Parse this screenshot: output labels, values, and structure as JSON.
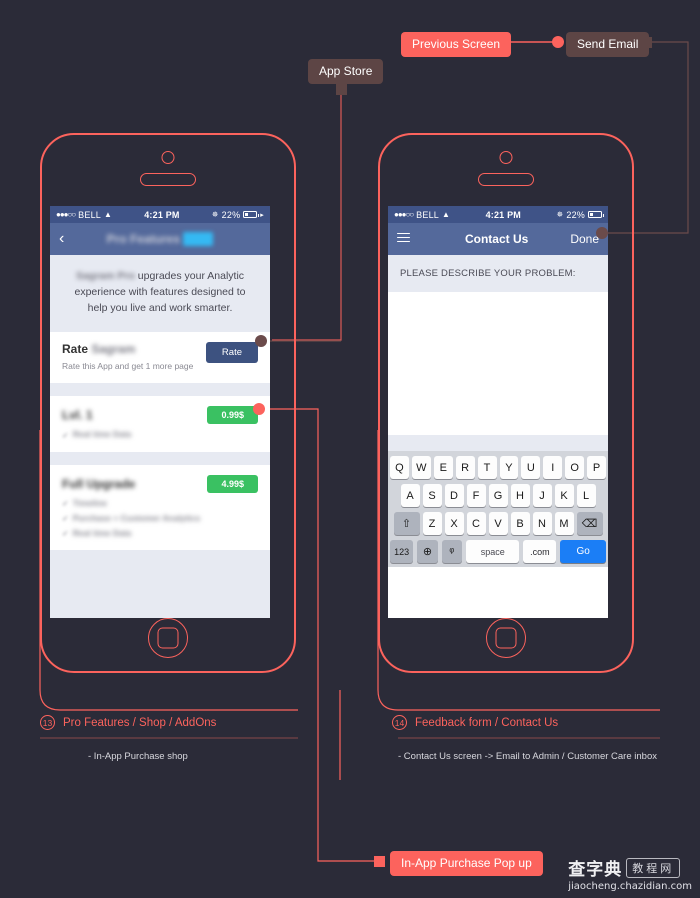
{
  "annotations": {
    "app_store": "App Store",
    "previous_screen": "Previous Screen",
    "send_email": "Send Email",
    "inapp_popup": "In-App Purchase Pop up"
  },
  "left_phone": {
    "statusbar": {
      "dots": "●●●○○",
      "carrier": "BELL",
      "wifi": "▲",
      "time": "4:21 PM",
      "bluetooth": "✵",
      "battery_pct": "22%",
      "arrow": "▸"
    },
    "navbar": {
      "back": "‹",
      "title": "Pro Features",
      "badge": "PRO"
    },
    "intro": {
      "redacted": "Sagram Pro",
      "text": " upgrades your Analytic experience with features designed to help you live and work smarter."
    },
    "rows": [
      {
        "title_plain": "Rate",
        "title_redacted": "Sagram",
        "subtitle": "Rate this App and get 1 more page",
        "button": "Rate",
        "button_type": "rate"
      },
      {
        "title_redacted": "Lvl. 1",
        "features": [
          "Real time Data"
        ],
        "button": "0.99$",
        "button_type": "price"
      },
      {
        "title_redacted": "Full Upgrade",
        "features": [
          "Timeline",
          "Purchase + Customer Analytics",
          "Real time Data"
        ],
        "button": "4.99$",
        "button_type": "price"
      }
    ]
  },
  "right_phone": {
    "statusbar": {
      "dots": "●●●○○",
      "carrier": "BELL",
      "wifi": "▲",
      "time": "4:21 PM",
      "bluetooth": "✵",
      "battery_pct": "22%"
    },
    "navbar": {
      "menu": "menu-icon",
      "title": "Contact Us",
      "action": "Done"
    },
    "form": {
      "label": "PLEASE DESCRIBE YOUR PROBLEM:",
      "textarea_value": ""
    },
    "keyboard": {
      "row1": [
        "Q",
        "W",
        "E",
        "R",
        "T",
        "Y",
        "U",
        "I",
        "O",
        "P"
      ],
      "row2": [
        "A",
        "S",
        "D",
        "F",
        "G",
        "H",
        "J",
        "K",
        "L"
      ],
      "row3_shift": "⇧",
      "row3": [
        "Z",
        "X",
        "C",
        "V",
        "B",
        "N",
        "M"
      ],
      "row3_delete": "⌫",
      "row4_numbers": "123",
      "row4_globe": "⊕",
      "row4_mic": "ᵠ",
      "row4_space": "space",
      "row4_domain": ".com",
      "row4_go": "Go"
    }
  },
  "captions": [
    {
      "number": "13",
      "title": "Pro Features / Shop / AddOns",
      "body": "- In-App Purchase shop"
    },
    {
      "number": "14",
      "title": "Feedback form / Contact Us",
      "body": "- Contact Us screen -> Email to Admin / Customer Care inbox"
    }
  ],
  "watermark": {
    "cn": "查字典",
    "box": "教程网",
    "url": "jiaocheng.chazidian.com"
  },
  "colors": {
    "background": "#2b2b38",
    "accent_red": "#fc635d",
    "pill_dark": "#5d4545",
    "nav_blue": "#54699b",
    "status_blue": "#3f5387",
    "green": "#3ac162",
    "rate_blue": "#3d5280",
    "go_blue": "#1b7ef6"
  }
}
